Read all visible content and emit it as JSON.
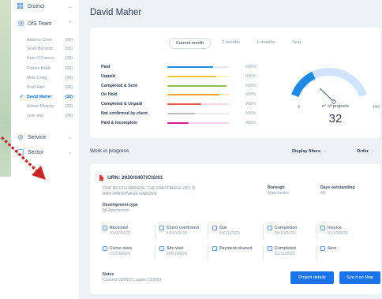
{
  "sidebar": {
    "district_label": "District",
    "team_label": "DfS Team",
    "members": [
      {
        "name": "Andrew Crow",
        "count": "(00)"
      },
      {
        "name": "Sean Barstow",
        "count": "(00)"
      },
      {
        "name": "Kate O'Connor",
        "count": "(00)"
      },
      {
        "name": "Patrick Babb",
        "count": "(00)"
      },
      {
        "name": "Mike Craig",
        "count": "(00)"
      },
      {
        "name": "Brad Hart",
        "count": "(00)"
      },
      {
        "name": "David Maher",
        "count": "(32)"
      },
      {
        "name": "Adrian Murphy",
        "count": "(00)"
      },
      {
        "name": "Julie Hall",
        "count": "(00)"
      }
    ],
    "service_label": "Service",
    "sector_label": "Sector"
  },
  "header": {
    "title": "David Maher"
  },
  "period_tabs": [
    "Current month",
    "3 months",
    "6 months",
    "Year"
  ],
  "metrics": [
    {
      "label": "Paid",
      "percent": "000%",
      "color": "#1e88e5",
      "track": "#dbe9f9",
      "fill": 0.74
    },
    {
      "label": "Unpaid",
      "percent": "000%",
      "color": "#fbc02d",
      "track": "#fcefc9",
      "fill": 0.8
    },
    {
      "label": "Completed & Sent",
      "percent": "000%",
      "color": "#8bc34a",
      "track": "#e4f1d6",
      "fill": 0.96
    },
    {
      "label": "On Hold",
      "percent": "000%",
      "color": "#f9a825",
      "track": "#fde9c3",
      "fill": 0.84
    },
    {
      "label": "Completed & Unpaid",
      "percent": "000%",
      "color": "#ef5350",
      "track": "#fbdada",
      "fill": 0.55
    },
    {
      "label": "Not confirmed by client",
      "percent": "000%",
      "color": "#bdbdbd",
      "track": "#ececec",
      "fill": 0.45
    },
    {
      "label": "Paid & Incomplete",
      "percent": "000%",
      "color": "#d81b9a",
      "track": "#f6d3ec",
      "fill": 0.34
    }
  ],
  "gauge": {
    "min": "0",
    "max": "100",
    "label": "n° of projects",
    "value": "32",
    "level": 0.32,
    "color": "#1e88e5",
    "track": "#cfe4fb"
  },
  "work_in_progress": {
    "title": "Work in progress",
    "filters_label": "Display filters",
    "order_label": "Order"
  },
  "project": {
    "urn": "URN: 2020/0407/CIS/01",
    "address_line1": "ONE NORTH PARADE, THE PARSONAGE (NO 3)",
    "address_line2": "AND PARSONAGE GARDEN",
    "borough_label": "Borough",
    "borough_value": "Manchester",
    "days_label": "Days outstanding",
    "days_value": "40",
    "dev_type_label": "Development type",
    "dev_type_value": "36 Apartments",
    "steps_row1": [
      {
        "label": "Received",
        "date": "01/07/2020"
      },
      {
        "label": "Client confirmed",
        "date": "19/10/2020"
      },
      {
        "label": "Due",
        "date": "19/11/2020"
      },
      {
        "label": "Completion",
        "date": "20/10/2020"
      },
      {
        "label": "Invoice",
        "date": "21/10/2020"
      }
    ],
    "steps_row2": [
      {
        "label": "Crime stats",
        "date": "21/10/2020"
      },
      {
        "label": "Site visit",
        "date": "24/07/2020"
      },
      {
        "label": "Payment cleared",
        "date": ""
      },
      {
        "label": "Completed",
        "date": "12/11/2020"
      },
      {
        "label": "Sent",
        "date": ""
      }
    ],
    "notes_label": "Notes",
    "notes_value": "Chased 10/08/20, again 23/9/20",
    "details_button": "Project details",
    "map_button": "See it on Map"
  },
  "annotation_color": "#c62828"
}
